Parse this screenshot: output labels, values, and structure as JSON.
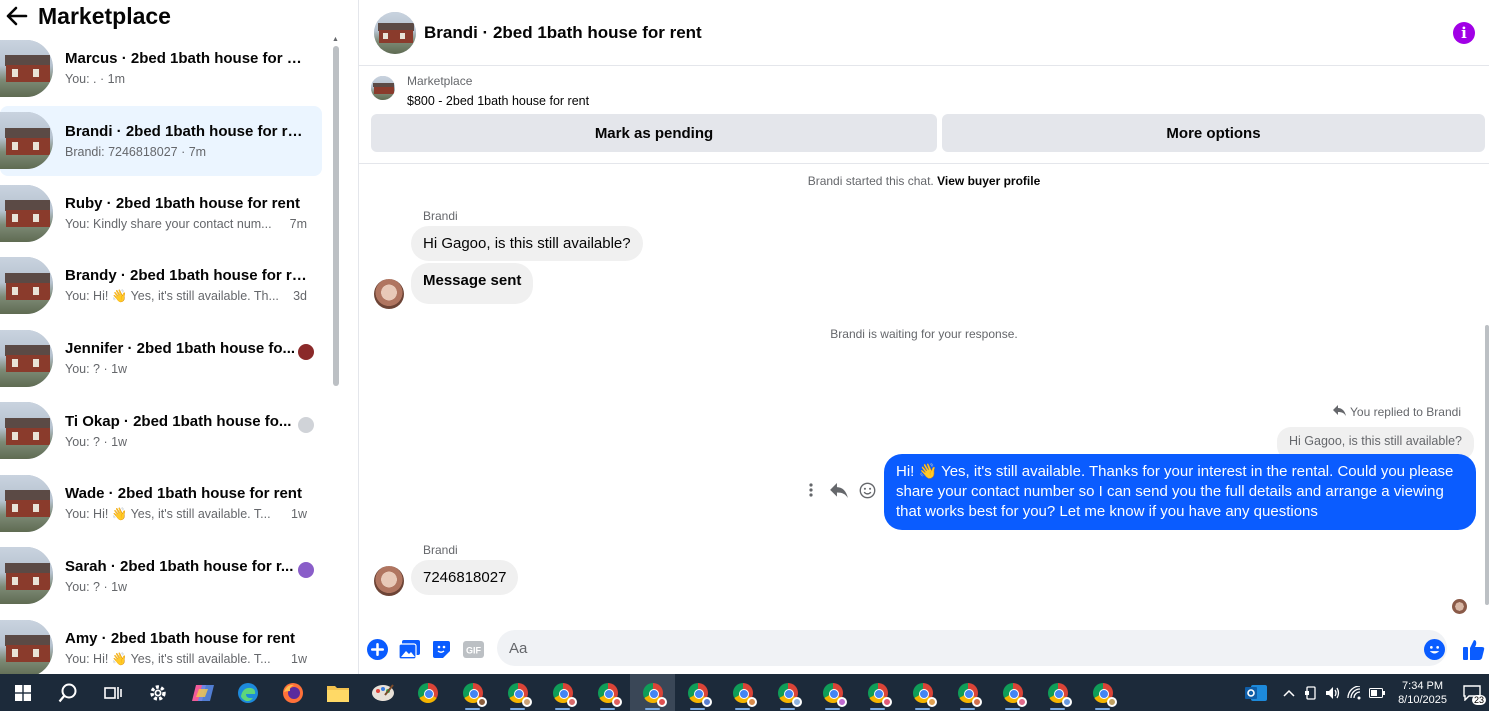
{
  "sidebar": {
    "title": "Marketplace",
    "conversations": [
      {
        "name": "Marcus · 2bed 1bath house for re...",
        "preview": "You: . · 1m",
        "time": "",
        "active": false,
        "badge": ""
      },
      {
        "name": "Brandi · 2bed 1bath house for rent",
        "preview": "Brandi: 7246818027 · 7m",
        "time": "",
        "active": true,
        "badge": ""
      },
      {
        "name": "Ruby · 2bed 1bath house for rent",
        "preview": "You: Kindly share your contact num...",
        "time": "7m",
        "active": false,
        "badge": ""
      },
      {
        "name": "Brandy · 2bed 1bath house for rent",
        "preview": "You: Hi! 👋 Yes, it's still available. Th...",
        "time": "3d",
        "active": false,
        "badge": ""
      },
      {
        "name": "Jennifer · 2bed 1bath house fo...",
        "preview": "You: ? · 1w",
        "time": "",
        "active": false,
        "badge": "#8b2a2a"
      },
      {
        "name": "Ti Okap · 2bed 1bath house fo...",
        "preview": "You: ? · 1w",
        "time": "",
        "active": false,
        "badge": "#d0d3d8"
      },
      {
        "name": "Wade · 2bed 1bath house for rent",
        "preview": "You: Hi! 👋 Yes, it's still available. T...",
        "time": "1w",
        "active": false,
        "badge": ""
      },
      {
        "name": "Sarah · 2bed 1bath house for r...",
        "preview": "You: ? · 1w",
        "time": "",
        "active": false,
        "badge": "#8a5ec9"
      },
      {
        "name": "Amy · 2bed 1bath house for rent",
        "preview": "You: Hi! 👋 Yes, it's still available. T...",
        "time": "1w",
        "active": false,
        "badge": ""
      }
    ]
  },
  "header": {
    "title": "Brandi · 2bed 1bath house for rent"
  },
  "listing": {
    "label": "Marketplace",
    "price_title": "$800 - 2bed 1bath house for rent",
    "pending_button": "Mark as pending",
    "more_button": "More options"
  },
  "chat": {
    "started_text": "Brandi started this chat.",
    "view_profile": "View buyer profile",
    "sender_1": "Brandi",
    "msg_1": "Hi Gagoo, is this still available?",
    "msg_2": "Message sent",
    "waiting_text": "Brandi is waiting for your response.",
    "replied_label": "You replied to Brandi",
    "quoted": "Hi Gagoo, is this still available?",
    "outgoing": "Hi! 👋 Yes, it's still available. Thanks for your interest in the rental. Could you please share your contact number so I can send you the full details and arrange a viewing that works best for you? Let me know if you have any questions",
    "sender_2": "Brandi",
    "msg_3": "7246818027"
  },
  "composer": {
    "placeholder": "Aa"
  },
  "taskbar": {
    "time": "7:34 PM",
    "date": "8/10/2025",
    "notification_count": "23"
  },
  "colors": {
    "accent": "#0a5cff",
    "info": "#a100e6",
    "active_conv": "#ebf5ff",
    "taskbar": "#1c2a3a"
  }
}
